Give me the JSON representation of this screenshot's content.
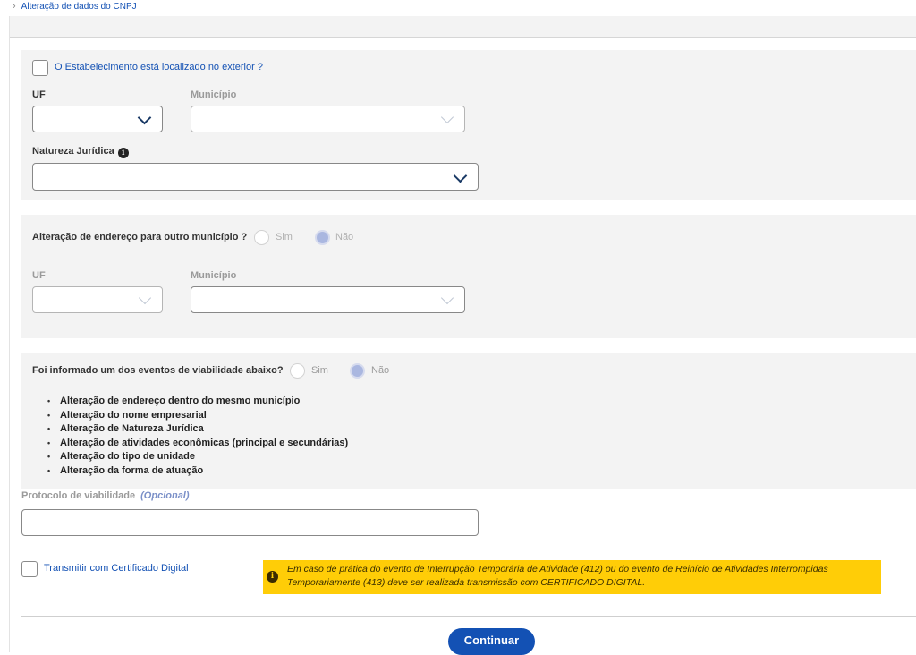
{
  "breadcrumb": {
    "label": "Alteração de dados do CNPJ"
  },
  "location_section": {
    "exterior_checkbox_label": "O Estabelecimento está localizado no exterior ?",
    "uf_label": "UF",
    "municipio_label": "Município",
    "uf_value": "",
    "municipio_value": "",
    "natureza_label": "Natureza Jurídica"
  },
  "address_change": {
    "question": "Alteração de endereço para outro município ?",
    "option_yes": "Sim",
    "option_no": "Não",
    "selected": "Não",
    "uf_label": "UF",
    "municipio_label": "Município"
  },
  "viability": {
    "question": "Foi informado um dos eventos de viabilidade abaixo?",
    "option_yes": "Sim",
    "option_no": "Não",
    "selected": "Não",
    "events": [
      "Alteração de endereço dentro do mesmo município",
      "Alteração do nome empresarial",
      "Alteração de Natureza Jurídica",
      "Alteração de atividades econômicas (principal e secundárias)",
      "Alteração do tipo de unidade",
      "Alteração da forma de atuação"
    ],
    "protocol_label": "Protocolo de viabilidade",
    "protocol_optional": "(Opcional)",
    "protocol_value": ""
  },
  "certificate": {
    "checkbox_label": "Transmitir com Certificado Digital",
    "alert_text": "Em caso de prática do evento de Interrupção Temporária de Atividade (412) ou do evento de Reinício de Atividades Interrompidas Temporariamente (413) deve ser realizada transmissão com CERTIFICADO DIGITAL."
  },
  "actions": {
    "continue_label": "Continuar"
  },
  "colors": {
    "primary": "#1351b4",
    "alert": "#ffcd07",
    "panel": "#f3f3f3"
  },
  "icons": {
    "info": "info-icon",
    "chevron": "chevron-down-icon",
    "alert": "warning-icon"
  }
}
